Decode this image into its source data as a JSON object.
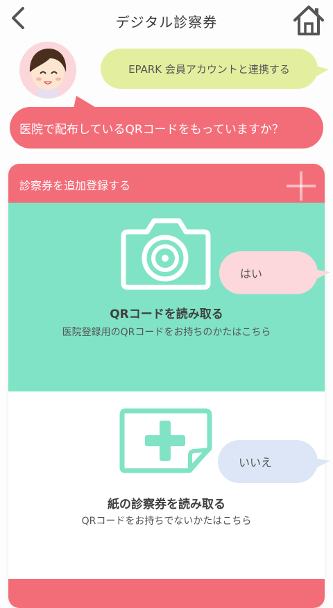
{
  "header": {
    "title": "デジタル診察券",
    "back_icon": "chevron-left-icon",
    "home_icon": "home-icon"
  },
  "chat": {
    "epark_link": "EPARK 会員アカウントと連携する",
    "question": "医院で配布しているQRコードをもっていますか？"
  },
  "panel": {
    "heading": "診察券を追加登録する",
    "qr_option": {
      "title": "QRコードを読み取る",
      "subtitle": "医院登録用のQRコードをお持ちのかたはこちら"
    },
    "paper_option": {
      "title": "紙の診察券を読み取る",
      "subtitle": "QRコードをお持ちでないかたはこちら"
    }
  },
  "answers": {
    "yes": "はい",
    "no": "いいえ"
  },
  "colors": {
    "pink": "#f36d79",
    "mint": "#80e3c5",
    "lime": "#e3ef9f"
  }
}
